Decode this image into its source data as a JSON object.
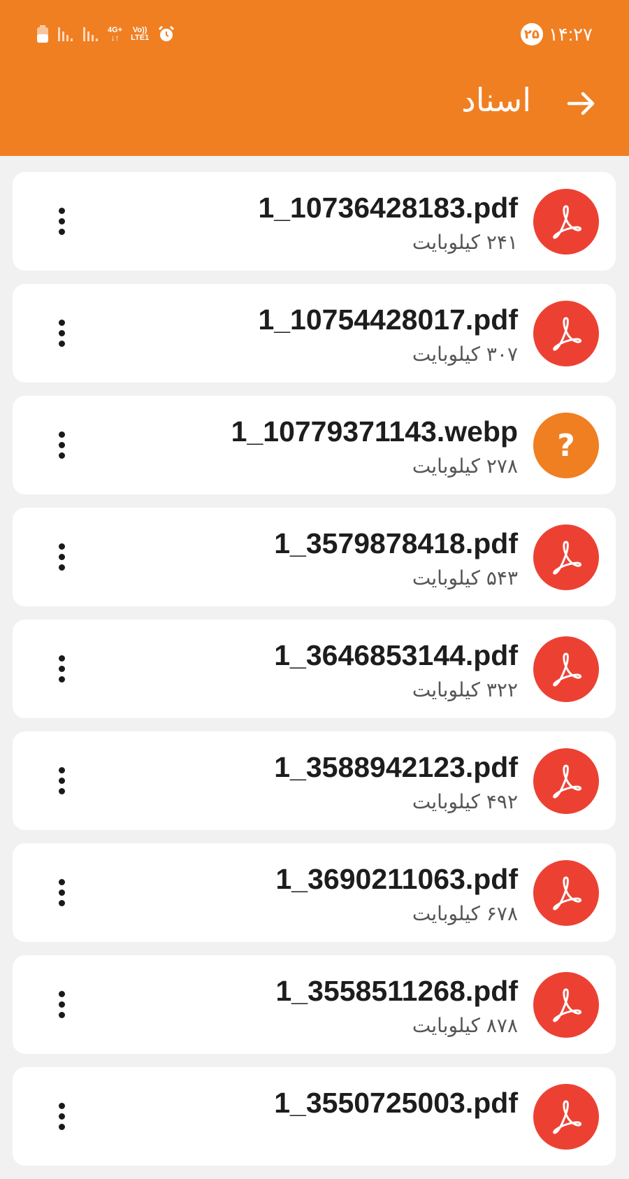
{
  "status_bar": {
    "time": "۱۴:۲۷",
    "notification_count": "۲۵",
    "network_label_top": "4G+",
    "network_label_bottom": "",
    "volte_label_top": "Vo))",
    "volte_label_bottom": "LTE1",
    "icons": [
      "battery-icon",
      "signal-icon",
      "signal-icon",
      "network-icon",
      "volte-icon",
      "alarm-icon"
    ]
  },
  "header": {
    "title": "اسناد",
    "back_icon": "arrow-right-icon",
    "background_color": "#f07f22"
  },
  "files": [
    {
      "name": "1_10736428183.pdf",
      "size": "۲۴۱ کیلوبایت",
      "type": "pdf"
    },
    {
      "name": "1_10754428017.pdf",
      "size": "۳۰۷ کیلوبایت",
      "type": "pdf"
    },
    {
      "name": "1_10779371143.webp",
      "size": "۲۷۸ کیلوبایت",
      "type": "unknown"
    },
    {
      "name": "1_3579878418.pdf",
      "size": "۵۴۳ کیلوبایت",
      "type": "pdf"
    },
    {
      "name": "1_3646853144.pdf",
      "size": "۳۲۲ کیلوبایت",
      "type": "pdf"
    },
    {
      "name": "1_3588942123.pdf",
      "size": "۴۹۲ کیلوبایت",
      "type": "pdf"
    },
    {
      "name": "1_3690211063.pdf",
      "size": "۶۷۸ کیلوبایت",
      "type": "pdf"
    },
    {
      "name": "1_3558511268.pdf",
      "size": "۸۷۸ کیلوبایت",
      "type": "pdf"
    },
    {
      "name": "1_3550725003.pdf",
      "size": "",
      "type": "pdf"
    }
  ],
  "colors": {
    "pdf_icon": "#ec4132",
    "unknown_icon": "#f07f22",
    "card": "#ffffff",
    "background": "#f1f1f1"
  }
}
